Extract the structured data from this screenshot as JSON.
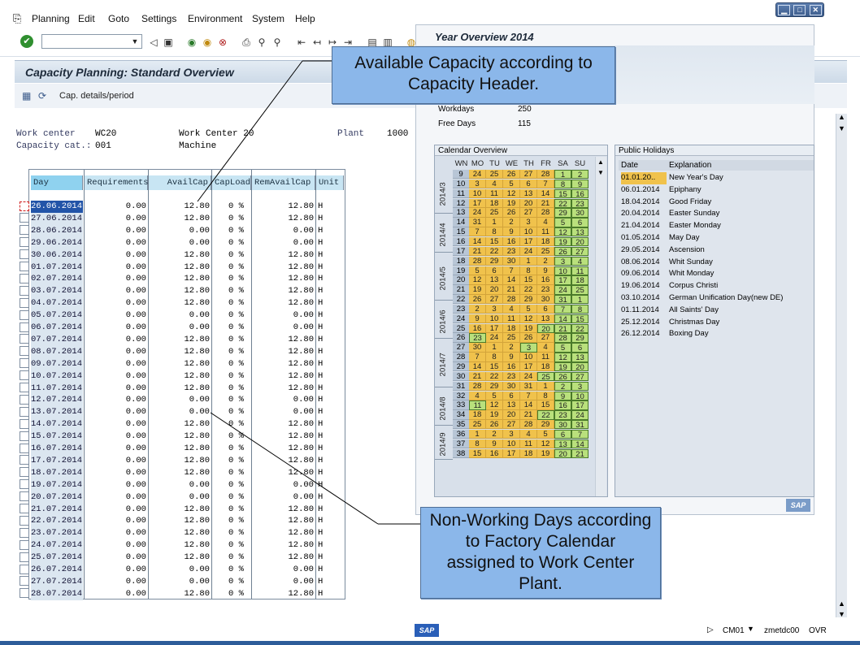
{
  "menu": [
    {
      "label": "Planning"
    },
    {
      "label": "Edit"
    },
    {
      "label": "Goto"
    },
    {
      "label": "Settings"
    },
    {
      "label": "Environment"
    },
    {
      "label": "System"
    },
    {
      "label": "Help"
    }
  ],
  "window_controls": [
    "▁",
    "□",
    "✕"
  ],
  "toolbar": {
    "command_field": ""
  },
  "title": "Capacity Planning: Standard Overview",
  "app_toolbar": {
    "cap_details_label": "Cap. details/period"
  },
  "header": {
    "work_center_label": "Work center",
    "work_center_value": "WC20",
    "work_center_desc": "Work Center 20",
    "plant_label": "Plant",
    "plant_value": "1000",
    "capacity_cat_label": "Capacity cat.:",
    "capacity_cat_value": "001",
    "capacity_cat_desc": "Machine"
  },
  "grid": {
    "columns": [
      "Day",
      "Requirements",
      "AvailCap",
      "CapLoad",
      "RemAvailCap",
      "Unit"
    ],
    "rows": [
      [
        "26.06.2014",
        "0.00",
        "12.80",
        "0 %",
        "12.80",
        "H"
      ],
      [
        "27.06.2014",
        "0.00",
        "12.80",
        "0 %",
        "12.80",
        "H"
      ],
      [
        "28.06.2014",
        "0.00",
        "0.00",
        "0 %",
        "0.00",
        "H"
      ],
      [
        "29.06.2014",
        "0.00",
        "0.00",
        "0 %",
        "0.00",
        "H"
      ],
      [
        "30.06.2014",
        "0.00",
        "12.80",
        "0 %",
        "12.80",
        "H"
      ],
      [
        "01.07.2014",
        "0.00",
        "12.80",
        "0 %",
        "12.80",
        "H"
      ],
      [
        "02.07.2014",
        "0.00",
        "12.80",
        "0 %",
        "12.80",
        "H"
      ],
      [
        "03.07.2014",
        "0.00",
        "12.80",
        "0 %",
        "12.80",
        "H"
      ],
      [
        "04.07.2014",
        "0.00",
        "12.80",
        "0 %",
        "12.80",
        "H"
      ],
      [
        "05.07.2014",
        "0.00",
        "0.00",
        "0 %",
        "0.00",
        "H"
      ],
      [
        "06.07.2014",
        "0.00",
        "0.00",
        "0 %",
        "0.00",
        "H"
      ],
      [
        "07.07.2014",
        "0.00",
        "12.80",
        "0 %",
        "12.80",
        "H"
      ],
      [
        "08.07.2014",
        "0.00",
        "12.80",
        "0 %",
        "12.80",
        "H"
      ],
      [
        "09.07.2014",
        "0.00",
        "12.80",
        "0 %",
        "12.80",
        "H"
      ],
      [
        "10.07.2014",
        "0.00",
        "12.80",
        "0 %",
        "12.80",
        "H"
      ],
      [
        "11.07.2014",
        "0.00",
        "12.80",
        "0 %",
        "12.80",
        "H"
      ],
      [
        "12.07.2014",
        "0.00",
        "0.00",
        "0 %",
        "0.00",
        "H"
      ],
      [
        "13.07.2014",
        "0.00",
        "0.00",
        "0 %",
        "0.00",
        "H"
      ],
      [
        "14.07.2014",
        "0.00",
        "12.80",
        "0 %",
        "12.80",
        "H"
      ],
      [
        "15.07.2014",
        "0.00",
        "12.80",
        "0 %",
        "12.80",
        "H"
      ],
      [
        "16.07.2014",
        "0.00",
        "12.80",
        "0 %",
        "12.80",
        "H"
      ],
      [
        "17.07.2014",
        "0.00",
        "12.80",
        "0 %",
        "12.80",
        "H"
      ],
      [
        "18.07.2014",
        "0.00",
        "12.80",
        "0 %",
        "12.80",
        "H"
      ],
      [
        "19.07.2014",
        "0.00",
        "0.00",
        "0 %",
        "0.00",
        "H"
      ],
      [
        "20.07.2014",
        "0.00",
        "0.00",
        "0 %",
        "0.00",
        "H"
      ],
      [
        "21.07.2014",
        "0.00",
        "12.80",
        "0 %",
        "12.80",
        "H"
      ],
      [
        "22.07.2014",
        "0.00",
        "12.80",
        "0 %",
        "12.80",
        "H"
      ],
      [
        "23.07.2014",
        "0.00",
        "12.80",
        "0 %",
        "12.80",
        "H"
      ],
      [
        "24.07.2014",
        "0.00",
        "12.80",
        "0 %",
        "12.80",
        "H"
      ],
      [
        "25.07.2014",
        "0.00",
        "12.80",
        "0 %",
        "12.80",
        "H"
      ],
      [
        "26.07.2014",
        "0.00",
        "0.00",
        "0 %",
        "0.00",
        "H"
      ],
      [
        "27.07.2014",
        "0.00",
        "0.00",
        "0 %",
        "0.00",
        "H"
      ],
      [
        "28.07.2014",
        "0.00",
        "12.80",
        "0 %",
        "12.80",
        "H"
      ]
    ]
  },
  "year_overview": {
    "title": "Year Overview 2014",
    "workdays_label": "Workdays",
    "workdays_value": "250",
    "freedays_label": "Free Days",
    "freedays_value": "115",
    "calendar_title": "Calendar Overview",
    "calendar_headers": [
      "WN",
      "MO",
      "TU",
      "WE",
      "TH",
      "FR",
      "SA",
      "SU"
    ],
    "weeks": [
      {
        "wn": "9",
        "d": [
          "24",
          "25",
          "26",
          "27",
          "28",
          "1",
          "2"
        ]
      },
      {
        "wn": "10",
        "d": [
          "3",
          "4",
          "5",
          "6",
          "7",
          "8",
          "9"
        ]
      },
      {
        "wn": "11",
        "d": [
          "10",
          "11",
          "12",
          "13",
          "14",
          "15",
          "16"
        ]
      },
      {
        "wn": "12",
        "d": [
          "17",
          "18",
          "19",
          "20",
          "21",
          "22",
          "23"
        ]
      },
      {
        "wn": "13",
        "d": [
          "24",
          "25",
          "26",
          "27",
          "28",
          "29",
          "30"
        ]
      },
      {
        "wn": "14",
        "d": [
          "31",
          "1",
          "2",
          "3",
          "4",
          "5",
          "6"
        ]
      },
      {
        "wn": "15",
        "d": [
          "7",
          "8",
          "9",
          "10",
          "11",
          "12",
          "13"
        ]
      },
      {
        "wn": "16",
        "d": [
          "14",
          "15",
          "16",
          "17",
          "18",
          "19",
          "20"
        ]
      },
      {
        "wn": "17",
        "d": [
          "21",
          "22",
          "23",
          "24",
          "25",
          "26",
          "27"
        ]
      },
      {
        "wn": "18",
        "d": [
          "28",
          "29",
          "30",
          "1",
          "2",
          "3",
          "4"
        ]
      },
      {
        "wn": "19",
        "d": [
          "5",
          "6",
          "7",
          "8",
          "9",
          "10",
          "11"
        ]
      },
      {
        "wn": "20",
        "d": [
          "12",
          "13",
          "14",
          "15",
          "16",
          "17",
          "18"
        ]
      },
      {
        "wn": "21",
        "d": [
          "19",
          "20",
          "21",
          "22",
          "23",
          "24",
          "25"
        ]
      },
      {
        "wn": "22",
        "d": [
          "26",
          "27",
          "28",
          "29",
          "30",
          "31",
          "1"
        ]
      },
      {
        "wn": "23",
        "d": [
          "2",
          "3",
          "4",
          "5",
          "6",
          "7",
          "8"
        ]
      },
      {
        "wn": "24",
        "d": [
          "9",
          "10",
          "11",
          "12",
          "13",
          "14",
          "15"
        ]
      },
      {
        "wn": "25",
        "d": [
          "16",
          "17",
          "18",
          "19",
          "20",
          "21",
          "22"
        ]
      },
      {
        "wn": "26",
        "d": [
          "23",
          "24",
          "25",
          "26",
          "27",
          "28",
          "29"
        ]
      },
      {
        "wn": "27",
        "d": [
          "30",
          "1",
          "2",
          "3",
          "4",
          "5",
          "6"
        ]
      },
      {
        "wn": "28",
        "d": [
          "7",
          "8",
          "9",
          "10",
          "11",
          "12",
          "13"
        ]
      },
      {
        "wn": "29",
        "d": [
          "14",
          "15",
          "16",
          "17",
          "18",
          "19",
          "20"
        ]
      },
      {
        "wn": "30",
        "d": [
          "21",
          "22",
          "23",
          "24",
          "25",
          "26",
          "27"
        ]
      },
      {
        "wn": "31",
        "d": [
          "28",
          "29",
          "30",
          "31",
          "1",
          "2",
          "3"
        ]
      },
      {
        "wn": "32",
        "d": [
          "4",
          "5",
          "6",
          "7",
          "8",
          "9",
          "10"
        ]
      },
      {
        "wn": "33",
        "d": [
          "11",
          "12",
          "13",
          "14",
          "15",
          "16",
          "17"
        ]
      },
      {
        "wn": "34",
        "d": [
          "18",
          "19",
          "20",
          "21",
          "22",
          "23",
          "24"
        ]
      },
      {
        "wn": "35",
        "d": [
          "25",
          "26",
          "27",
          "28",
          "29",
          "30",
          "31"
        ]
      },
      {
        "wn": "36",
        "d": [
          "1",
          "2",
          "3",
          "4",
          "5",
          "6",
          "7"
        ]
      },
      {
        "wn": "37",
        "d": [
          "8",
          "9",
          "10",
          "11",
          "12",
          "13",
          "14"
        ]
      },
      {
        "wn": "38",
        "d": [
          "15",
          "16",
          "17",
          "18",
          "19",
          "20",
          "21"
        ]
      }
    ],
    "holidays_marked": [
      [
        9,
        5
      ],
      [
        16,
        4
      ],
      [
        17,
        0
      ],
      [
        18,
        3
      ],
      [
        21,
        4
      ],
      [
        24,
        0
      ],
      [
        25,
        4
      ]
    ],
    "month_labels": [
      "2014/3",
      "2014/4",
      "2014/5",
      "2014/6",
      "2014/7",
      "2014/8",
      "2014/9"
    ],
    "public_holidays_title": "Public Holidays",
    "ph_headers": [
      "Date",
      "Explanation"
    ],
    "public_holidays": [
      [
        "01.01.20..",
        "New Year's Day"
      ],
      [
        "06.01.2014",
        "Epiphany"
      ],
      [
        "18.04.2014",
        "Good Friday"
      ],
      [
        "20.04.2014",
        "Easter Sunday"
      ],
      [
        "21.04.2014",
        "Easter Monday"
      ],
      [
        "01.05.2014",
        "May Day"
      ],
      [
        "29.05.2014",
        "Ascension"
      ],
      [
        "08.06.2014",
        "Whit Sunday"
      ],
      [
        "09.06.2014",
        "Whit Monday"
      ],
      [
        "19.06.2014",
        "Corpus Christi"
      ],
      [
        "03.10.2014",
        "German Unification Day(new DE)"
      ],
      [
        "01.11.2014",
        "All Saints' Day"
      ],
      [
        "25.12.2014",
        "Christmas Day"
      ],
      [
        "26.12.2014",
        "Boxing Day"
      ]
    ]
  },
  "callouts": {
    "available": "Available Capacity according to Capacity Header.",
    "nonworking": "Non-Working Days according to Factory Calendar assigned to Work Center Plant."
  },
  "status": {
    "logo": "SAP",
    "session": "CM01",
    "server": "zmetdc00",
    "mode": "OVR"
  }
}
